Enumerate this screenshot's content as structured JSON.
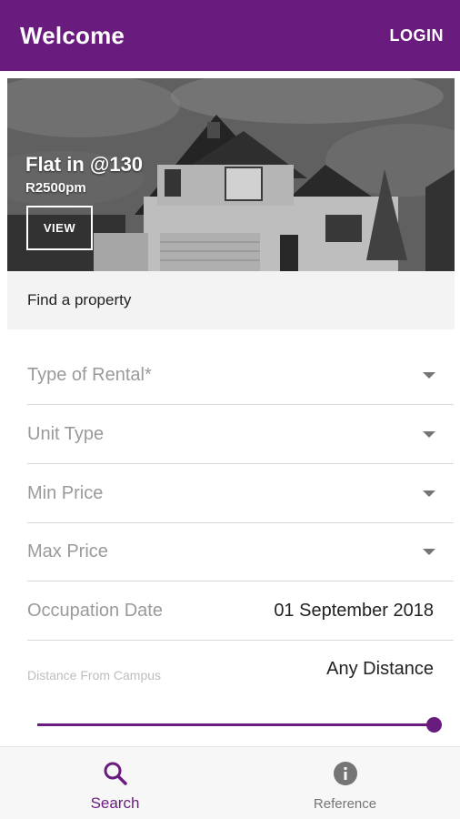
{
  "appbar": {
    "title": "Welcome",
    "login_label": "LOGIN",
    "color": "#6a1b7e"
  },
  "featured": {
    "name": "Flat in @130",
    "price": "R2500pm",
    "view_label": "VIEW"
  },
  "search": {
    "heading": "Find a property",
    "fields": [
      {
        "label": "Type of Rental*",
        "type": "dropdown"
      },
      {
        "label": "Unit Type",
        "type": "dropdown"
      },
      {
        "label": "Min Price",
        "type": "dropdown"
      },
      {
        "label": "Max Price",
        "type": "dropdown"
      }
    ],
    "occupation_date": {
      "label": "Occupation Date",
      "value": "01 September 2018"
    },
    "distance": {
      "label": "Distance From Campus",
      "value": "Any Distance",
      "slider_level": 1.0
    }
  },
  "bottom_nav": {
    "items": [
      {
        "label": "Search",
        "icon": "search-icon",
        "active": true
      },
      {
        "label": "Reference",
        "icon": "info-icon",
        "active": false
      }
    ]
  }
}
